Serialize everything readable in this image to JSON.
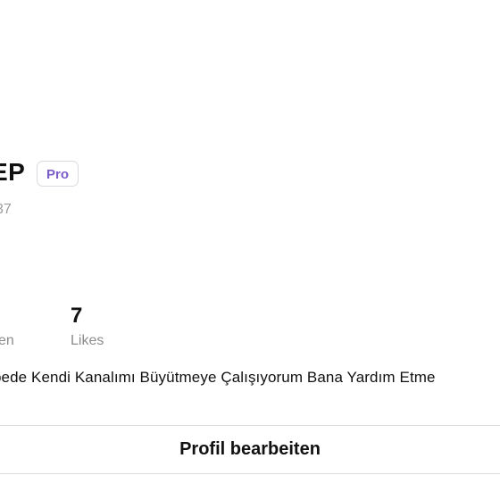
{
  "profile": {
    "name_fragment": "EP",
    "badge": "Pro",
    "handle_fragment": "37"
  },
  "stats": {
    "likes_count": "7",
    "likes_label": "Likes",
    "left_label_fragment": "en"
  },
  "bio": {
    "text": "bede Kendi Kanalımı Büyütmeye Çalışıyorum Bana Yardım Etme"
  },
  "actions": {
    "edit_profile_label": "Profil bearbeiten"
  }
}
